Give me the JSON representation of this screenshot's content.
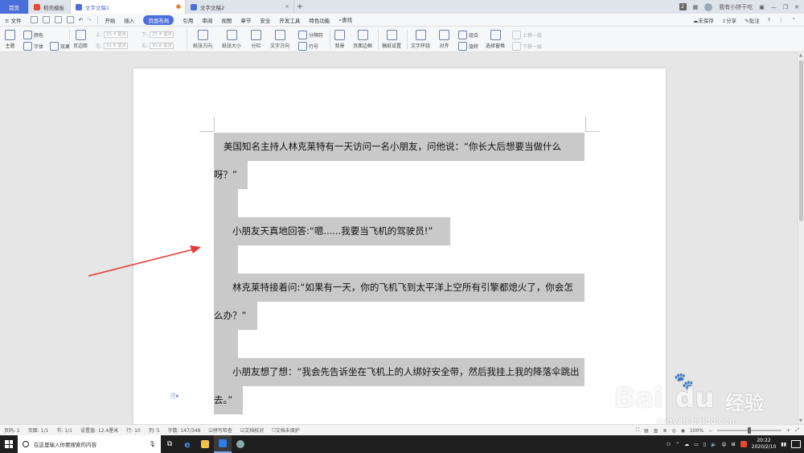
{
  "tabs": {
    "home": "首页",
    "t1": "稻壳模板",
    "t2": "文字文稿1",
    "t3": "文字文稿2",
    "plus": "+"
  },
  "titlebar_right": {
    "badge": "2",
    "user": "我有小拼干吃"
  },
  "menu": {
    "file": "≡ 文件",
    "items": [
      "开始",
      "插入",
      "页面布局",
      "引用",
      "审阅",
      "视图",
      "章节",
      "安全",
      "开发工具",
      "特色功能"
    ],
    "active_index": 2,
    "search": "查找",
    "unsaved": "未保存",
    "share": "分享",
    "comment": "批注",
    "help": "?"
  },
  "ribbon": {
    "theme": "主题",
    "color": "颜色",
    "font": "字体",
    "effect": "效果",
    "margin": "页边距",
    "top_label": "上:",
    "top_val": "25.4 毫米",
    "bottom_label": "下:",
    "bottom_val": "25.4 毫米",
    "left_label": "左:",
    "left_val": "31.8 毫米",
    "right_label": "右:",
    "right_val": "31.8 毫米",
    "orientation": "纸张方向",
    "size": "纸张大小",
    "columns": "分栏",
    "text_dir": "文字方向",
    "breaks": "分隔符",
    "line_num": "行号",
    "background": "背景",
    "page_border": "页面边框",
    "paper_setup": "稿纸设置",
    "wrap": "文字环绕",
    "align": "对齐",
    "group": "组合",
    "rotate": "旋转",
    "select_pane": "选择窗格",
    "bring_up": "上移一层",
    "send_down": "下移一层"
  },
  "document": {
    "p1_line1": "美国知名主持人林克莱特有一天访问一名小朋友，问他说：“你长大后想要当做什么",
    "p1_line2": "呀？”",
    "p2": "小朋友天真地回答:“嗯......我要当飞机的驾驶员!”",
    "p3_line1": "林克莱特接着问:“如果有一天，你的飞机飞到太平洋上空所有引擎都熄火了，你会怎",
    "p3_line2": "么办？”",
    "p4_line1": "小朋友想了想：“我会先告诉坐在飞机上的人绑好安全带，然后我挂上我的降落伞跳出",
    "p4_line2": "去。”"
  },
  "status": {
    "page": "页码: 1",
    "pages": "页面: 1/1",
    "section": "节: 1/1",
    "setting": "设置值: 12.4厘米",
    "row": "行: 10",
    "col": "列: 5",
    "words": "字数: 147/348",
    "spell": "拼写检查",
    "proof": "文档校对",
    "protect": "文档未保护",
    "zoom": "100%"
  },
  "taskbar": {
    "search_placeholder": "在这里输入你要搜索的内容",
    "time": "20:22",
    "date": "2020/2/10",
    "ime": "中"
  },
  "watermark": {
    "main": "Bai",
    "du": "du",
    "jingyan": "经验",
    "url": "jingyan.baidu.com"
  },
  "colors": {
    "accent": "#4a6fdc",
    "highlight": "#c9c9c9",
    "arrow": "#e53935"
  }
}
